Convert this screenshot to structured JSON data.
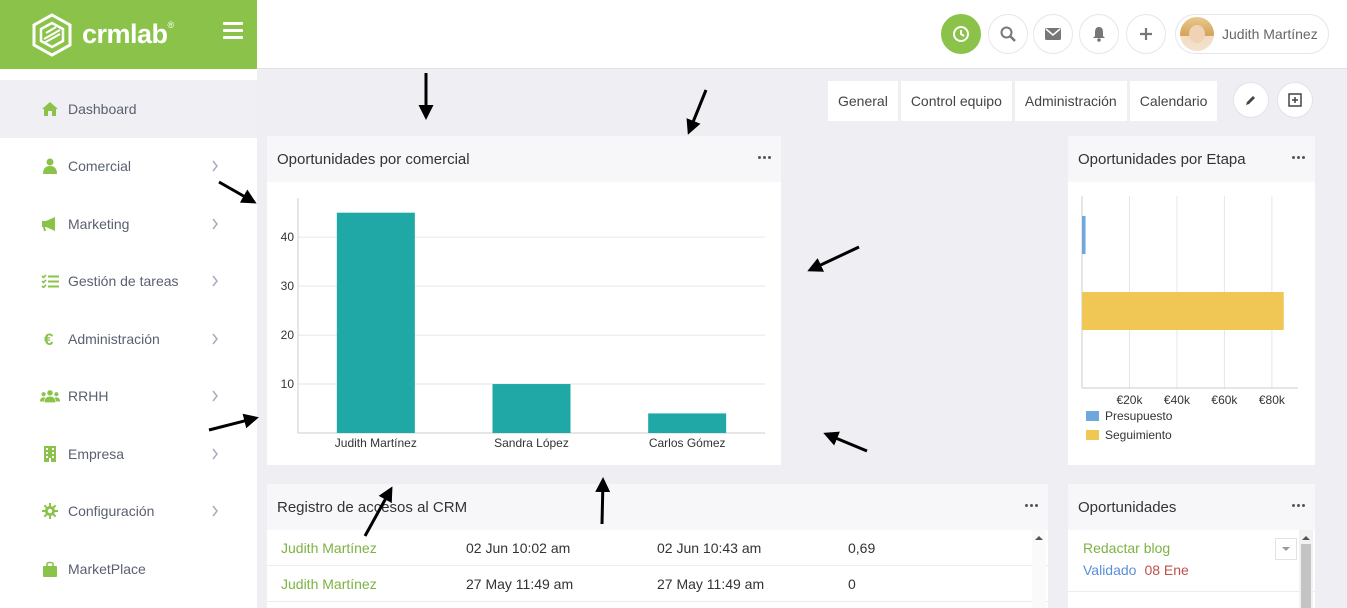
{
  "brand": {
    "name": "crmlab",
    "reg": "®",
    "color": "#8bc34a"
  },
  "sidebar": {
    "items": [
      {
        "label": "Dashboard",
        "icon": "home-icon",
        "active": true,
        "chevron": false
      },
      {
        "label": "Comercial",
        "icon": "user-icon",
        "chevron": true
      },
      {
        "label": "Marketing",
        "icon": "megaphone-icon",
        "chevron": true
      },
      {
        "label": "Gestión de tareas",
        "icon": "tasks-icon",
        "chevron": true
      },
      {
        "label": "Administración",
        "icon": "euro-icon",
        "chevron": true
      },
      {
        "label": "RRHH",
        "icon": "users-icon",
        "chevron": true
      },
      {
        "label": "Empresa",
        "icon": "building-icon",
        "chevron": true
      },
      {
        "label": "Configuración",
        "icon": "gear-icon",
        "chevron": true
      },
      {
        "label": "MarketPlace",
        "icon": "bag-icon",
        "chevron": false
      }
    ]
  },
  "topbar": {
    "user_name": "Judith Martínez",
    "buttons": [
      "clock-icon",
      "search-icon",
      "mail-icon",
      "bell-icon",
      "plus-icon"
    ]
  },
  "tabs": [
    "General",
    "Control equipo",
    "Administración",
    "Calendario"
  ],
  "panels": {
    "comercial": {
      "title": "Oportunidades por comercial"
    },
    "etapa": {
      "title": "Oportunidades por Etapa"
    },
    "registro": {
      "title": "Registro de accesos al CRM"
    },
    "oportunidades": {
      "title": "Oportunidades"
    }
  },
  "chart_data": [
    {
      "type": "bar",
      "categories": [
        "Judith Martínez",
        "Sandra López",
        "Carlos Gómez"
      ],
      "values": [
        45,
        10,
        4
      ],
      "yticks": [
        10,
        20,
        30,
        40
      ],
      "ylim": [
        0,
        48
      ],
      "color": "#1fa8a6",
      "grid": true
    },
    {
      "type": "bar",
      "orientation": "horizontal",
      "categories": [
        "Presupuesto",
        "Seguimiento"
      ],
      "values": [
        1500,
        85000
      ],
      "xticks": [
        "€20k",
        "€40k",
        "€60k",
        "€80k"
      ],
      "xtick_values": [
        20000,
        40000,
        60000,
        80000
      ],
      "xlim": [
        0,
        91000
      ],
      "colors": [
        "#6fa8dc",
        "#f0c654"
      ],
      "legend": [
        {
          "name": "Presupuesto",
          "color": "#6fa8dc"
        },
        {
          "name": "Seguimiento",
          "color": "#f0c654"
        }
      ],
      "legend_position": "bottom-left",
      "grid": true
    }
  ],
  "registro_rows": [
    {
      "user": "Judith Martínez",
      "login": "02 Jun 10:02 am",
      "logout": "02 Jun 10:43 am",
      "value": "0,69"
    },
    {
      "user": "Judith Martínez",
      "login": "27 May 11:49 am",
      "logout": "27 May 11:49 am",
      "value": "0"
    }
  ],
  "oportunidades_items": [
    {
      "title": "Redactar blog",
      "status": "Validado",
      "date": "08 Ene"
    }
  ]
}
